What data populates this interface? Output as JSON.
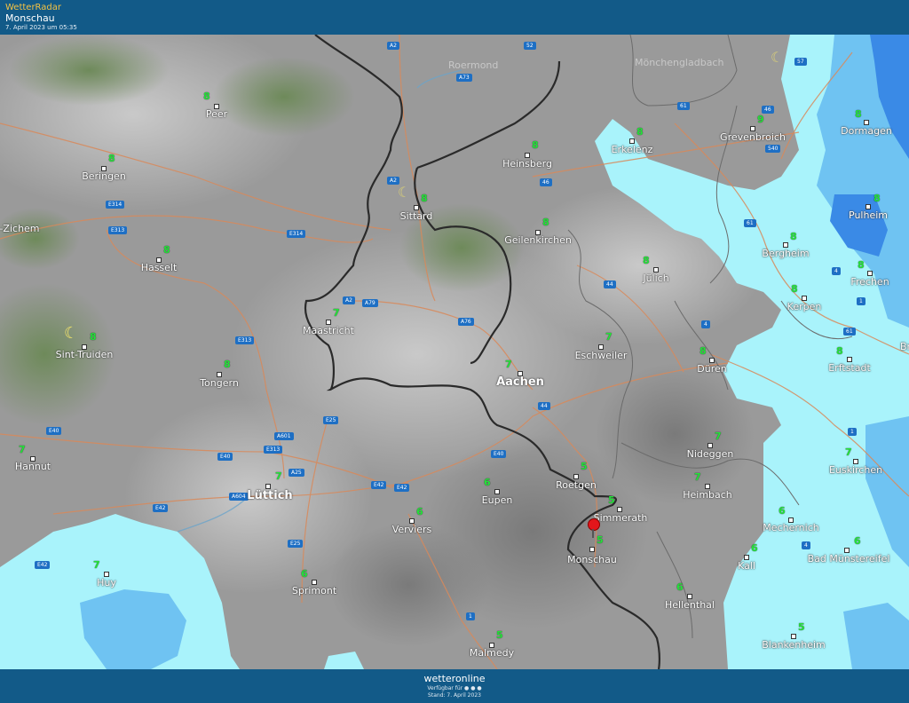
{
  "header": {
    "brand": "WetterRadar",
    "location": "Monschau",
    "timestamp": "7. April 2023 um 05:35"
  },
  "footer": {
    "logo": "wetteronline",
    "available": "Verfügbar für ● ● ●",
    "stand": "Stand: 7. April 2023"
  },
  "colors": {
    "terrain": "#9a9a9a",
    "forest": "#6e8a5a",
    "precip_light": "#a9f3fb",
    "precip_medium": "#6fc3f2",
    "precip_heavy": "#3a8ae6",
    "border": "#2a2a2a",
    "road": "#d9895a",
    "temp_text": "#25e13a"
  },
  "cities": [
    {
      "name": "Peer",
      "temp": "8"
    },
    {
      "name": "Beringen",
      "temp": "8"
    },
    {
      "name": "-Zichem",
      "temp": ""
    },
    {
      "name": "Hasselt",
      "temp": "8"
    },
    {
      "name": "Sint-Truiden",
      "temp": "8"
    },
    {
      "name": "Tongern",
      "temp": "8"
    },
    {
      "name": "Hannut",
      "temp": "7"
    },
    {
      "name": "Huy",
      "temp": "7"
    },
    {
      "name": "Lüttich",
      "temp": "7"
    },
    {
      "name": "Sprimont",
      "temp": "6"
    },
    {
      "name": "Verviers",
      "temp": "6"
    },
    {
      "name": "Malmedy",
      "temp": "5"
    },
    {
      "name": "Maastricht",
      "temp": "7"
    },
    {
      "name": "Sittard",
      "temp": "8"
    },
    {
      "name": "Heinsberg",
      "temp": "8"
    },
    {
      "name": "Geilenkirchen",
      "temp": "8"
    },
    {
      "name": "Erkelenz",
      "temp": "8"
    },
    {
      "name": "Grevenbroich",
      "temp": "9"
    },
    {
      "name": "Dormagen",
      "temp": "8"
    },
    {
      "name": "Pulheim",
      "temp": "8"
    },
    {
      "name": "Bergheim",
      "temp": "8"
    },
    {
      "name": "Frechen",
      "temp": "8"
    },
    {
      "name": "Kerpen",
      "temp": "8"
    },
    {
      "name": "Jülich",
      "temp": "8"
    },
    {
      "name": "Eschweiler",
      "temp": "7"
    },
    {
      "name": "Aachen",
      "temp": "7"
    },
    {
      "name": "Düren",
      "temp": "8"
    },
    {
      "name": "Erftstadt",
      "temp": "8"
    },
    {
      "name": "Nideggen",
      "temp": "7"
    },
    {
      "name": "Euskirchen",
      "temp": "7"
    },
    {
      "name": "Heimbach",
      "temp": "7"
    },
    {
      "name": "Mechernich",
      "temp": "6"
    },
    {
      "name": "Roetgen",
      "temp": "5"
    },
    {
      "name": "Eupen",
      "temp": "6"
    },
    {
      "name": "Simmerath",
      "temp": "5"
    },
    {
      "name": "Monschau",
      "temp": "5"
    },
    {
      "name": "Kall",
      "temp": "6"
    },
    {
      "name": "Bad Münstereifel",
      "temp": "6"
    },
    {
      "name": "Hellenthal",
      "temp": "6"
    },
    {
      "name": "Blankenheim",
      "temp": "5"
    },
    {
      "name": "Br",
      "temp": ""
    }
  ],
  "faint_labels": [
    "Roermond",
    "Mönchengladbach"
  ],
  "roads": [
    "A2",
    "52",
    "A73",
    "57",
    "61",
    "46",
    "540",
    "A2",
    "E314",
    "E313",
    "E314",
    "46",
    "61",
    "4",
    "44",
    "1",
    "A2",
    "A79",
    "A76",
    "4",
    "61",
    "E313",
    "E25",
    "44",
    "E40",
    "A601",
    "E313",
    "E40",
    "1",
    "A25",
    "E40",
    "E42",
    "A604",
    "E42",
    "E25",
    "E42",
    "E42",
    "1",
    "4"
  ],
  "moon_icon": "moon-icon",
  "marker_icon": "location-pin-icon"
}
